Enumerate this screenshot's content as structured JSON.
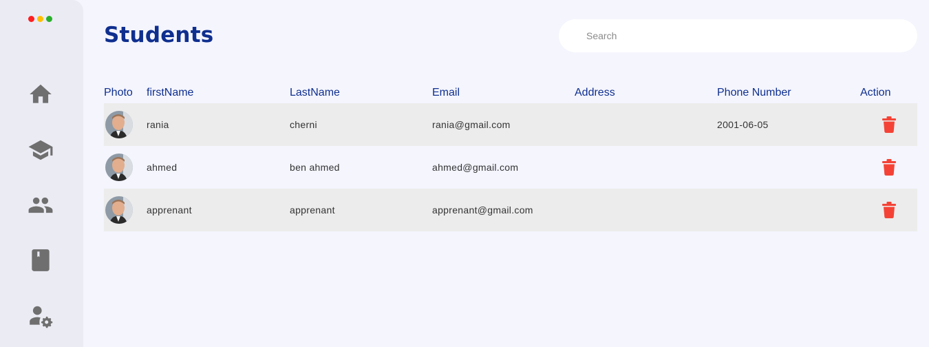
{
  "window_dots": [
    {
      "name": "close",
      "color": "#ff1f1f"
    },
    {
      "name": "minimize",
      "color": "#ffbf00"
    },
    {
      "name": "maximize",
      "color": "#2ab02a"
    }
  ],
  "sidebar": {
    "icon_color": "#6f6f6f",
    "items": [
      {
        "icon": "home-icon"
      },
      {
        "icon": "graduation-cap-icon"
      },
      {
        "icon": "people-icon"
      },
      {
        "icon": "book-icon"
      },
      {
        "icon": "user-settings-icon"
      }
    ]
  },
  "header": {
    "title": "Students",
    "search_placeholder": "Search"
  },
  "colors": {
    "primary": "#0f2f8f",
    "delete": "#f44336",
    "row_shade": "#ececec",
    "background": "#f4f5fd"
  },
  "table": {
    "columns": [
      "Photo",
      "firstName",
      "LastName",
      "Email",
      "Address",
      "Phone Number",
      "Action"
    ],
    "rows": [
      {
        "first": "rania",
        "last": "cherni",
        "email": "rania@gmail.com",
        "address": "",
        "phone": "2001-06-05"
      },
      {
        "first": "ahmed",
        "last": "ben ahmed",
        "email": "ahmed@gmail.com",
        "address": "",
        "phone": ""
      },
      {
        "first": "apprenant",
        "last": "apprenant",
        "email": "apprenant@gmail.com",
        "address": "",
        "phone": ""
      }
    ]
  }
}
